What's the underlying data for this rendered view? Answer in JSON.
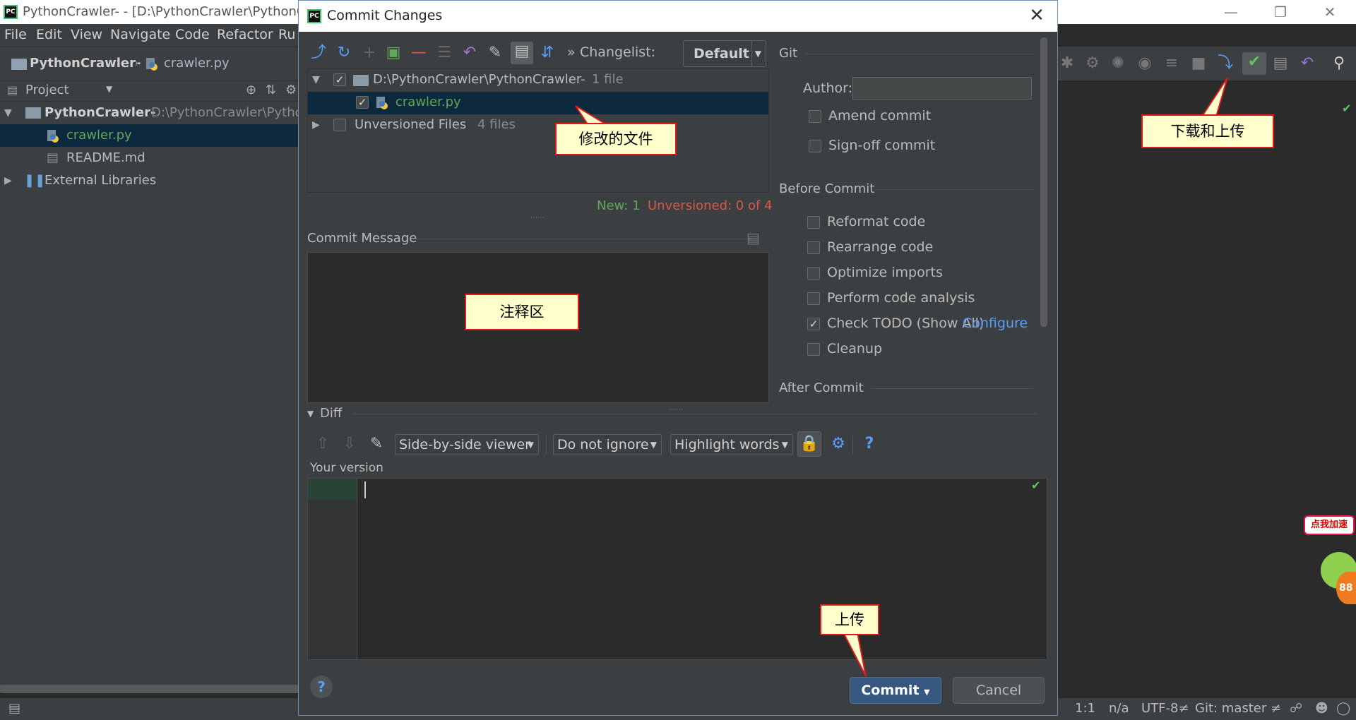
{
  "ide": {
    "title": "PythonCrawler- - [D:\\PythonCrawler\\PythonC",
    "menu": [
      "File",
      "Edit",
      "View",
      "Navigate",
      "Code",
      "Refactor",
      "Ru"
    ],
    "breadcrumb": [
      "PythonCrawler-",
      "crawler.py"
    ],
    "project_header": "Project",
    "tree": {
      "root_name": "PythonCrawler-",
      "root_path": "D:\\PythonCrawler\\Pytho",
      "file1": "crawler.py",
      "file2": "README.md",
      "ext": "External Libraries"
    },
    "status": {
      "pos": "1:1",
      "na": "n/a",
      "encoding": "UTF-8≠",
      "git": "Git: master ≠"
    },
    "annotation_badge": "点我加速",
    "annotation_badge_num": "88"
  },
  "dialog": {
    "title": "Commit Changes",
    "changelist_label": "Changelist:",
    "changelist_value": "Default",
    "files": {
      "root_path": "D:\\PythonCrawler\\PythonCrawler-",
      "root_count": "1 file",
      "file": "crawler.py",
      "unversioned": "Unversioned Files",
      "unversioned_count": "4 files"
    },
    "summary_new": "New: 1",
    "summary_unversioned": "Unversioned: 0 of 4",
    "commit_message_label": "Commit Message",
    "git": {
      "section": "Git",
      "author_label": "Author:",
      "author_value": "",
      "amend": "Amend commit",
      "signoff": "Sign-off commit"
    },
    "before_commit": {
      "section": "Before Commit",
      "options": [
        {
          "label": "Reformat code",
          "checked": false
        },
        {
          "label": "Rearrange code",
          "checked": false
        },
        {
          "label": "Optimize imports",
          "checked": false
        },
        {
          "label": "Perform code analysis",
          "checked": false
        },
        {
          "label": "Check TODO (Show All)",
          "checked": true
        },
        {
          "label": "Cleanup",
          "checked": false
        }
      ],
      "configure_link": "Configure"
    },
    "after_commit": "After Commit",
    "diff": {
      "label": "Diff",
      "viewer": "Side-by-side viewer",
      "ignore": "Do not ignore",
      "highlight": "Highlight words",
      "your_version": "Your version"
    },
    "buttons": {
      "commit": "Commit",
      "cancel": "Cancel",
      "help": "?"
    }
  },
  "callouts": {
    "modified_files": "修改的文件",
    "comment_area": "注释区",
    "download_upload": "下载和上传",
    "upload": "上传"
  },
  "colors": {
    "accent_blue": "#589df6",
    "link": "#589df6",
    "new_green": "#62a55b",
    "unversioned_red": "#d65a4a",
    "callout_border": "#e01a1a",
    "callout_bg": "#ffffcc"
  }
}
